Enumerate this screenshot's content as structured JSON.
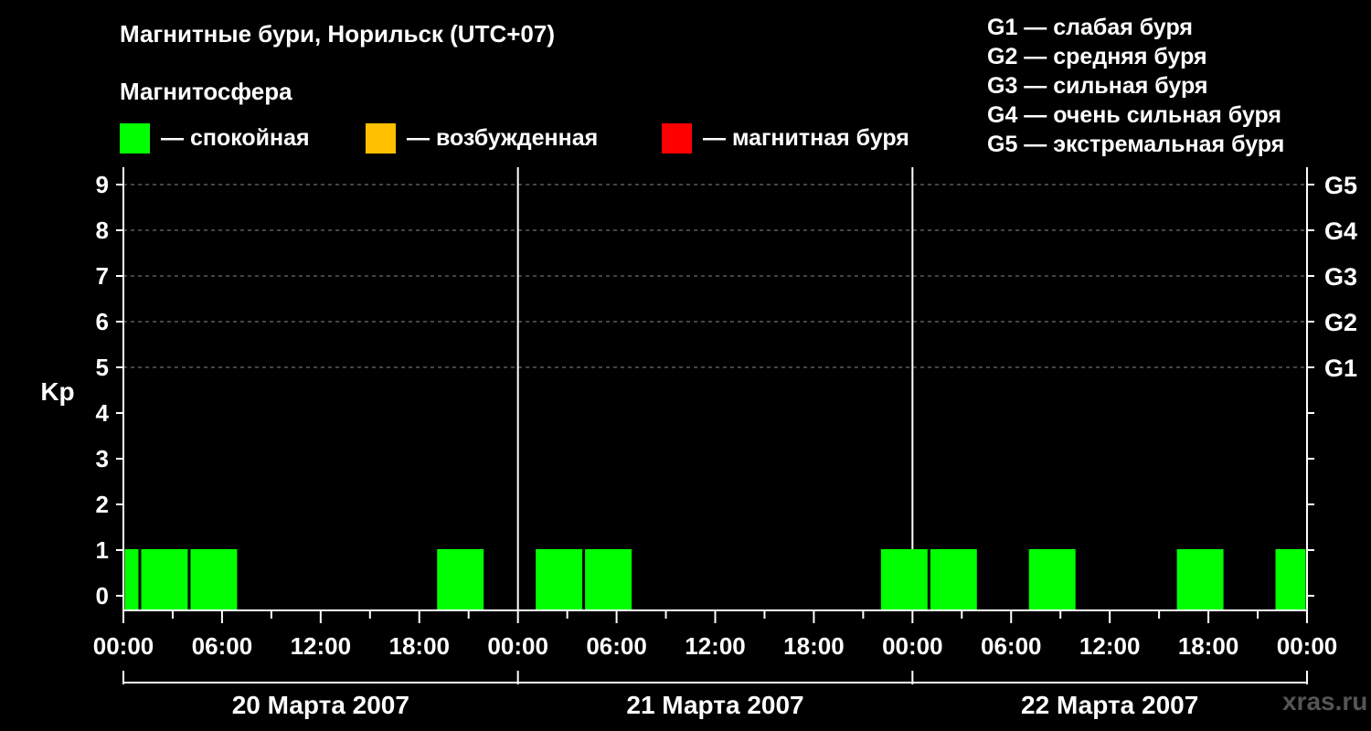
{
  "title": "Магнитные бури, Норильск (UTC+07)",
  "legend": {
    "heading": "Магнитосфера",
    "items": [
      {
        "label": "— спокойная",
        "color": "#00ff00"
      },
      {
        "label": "— возбужденная",
        "color": "#ffc000"
      },
      {
        "label": "— магнитная буря",
        "color": "#ff0000"
      }
    ]
  },
  "g_scale": [
    "G1 — слабая буря",
    "G2 — средняя буря",
    "G3 — сильная буря",
    "G4 — очень сильная буря",
    "G5 — экстремальная буря"
  ],
  "watermark": "xras.ru",
  "chart_data": {
    "type": "bar",
    "ylabel": "Kp",
    "ylim": [
      0,
      9
    ],
    "y_ticks": [
      0,
      1,
      2,
      3,
      4,
      5,
      6,
      7,
      8,
      9
    ],
    "right_axis_labels": [
      {
        "kp": 5,
        "label": "G1"
      },
      {
        "kp": 6,
        "label": "G2"
      },
      {
        "kp": 7,
        "label": "G3"
      },
      {
        "kp": 8,
        "label": "G4"
      },
      {
        "kp": 9,
        "label": "G5"
      }
    ],
    "x_range_hours": [
      0,
      72
    ],
    "x_tick_labels": [
      "00:00",
      "06:00",
      "12:00",
      "18:00",
      "00:00",
      "06:00",
      "12:00",
      "18:00",
      "00:00",
      "06:00",
      "12:00",
      "18:00",
      "00:00"
    ],
    "days": [
      "20 Марта 2007",
      "21 Марта 2007",
      "22 Марта 2007"
    ],
    "grid": "horizontal dashed at Kp 5–9",
    "bars": [
      {
        "start": "20 Марта 2007 00:00",
        "end": "20 Марта 2007 01:00",
        "kp": 1,
        "status": "спокойная"
      },
      {
        "start": "20 Марта 2007 01:00",
        "end": "20 Марта 2007 04:00",
        "kp": 1,
        "status": "спокойная"
      },
      {
        "start": "20 Марта 2007 04:00",
        "end": "20 Марта 2007 07:00",
        "kp": 1,
        "status": "спокойная"
      },
      {
        "start": "20 Марта 2007 19:00",
        "end": "20 Марта 2007 22:00",
        "kp": 1,
        "status": "спокойная"
      },
      {
        "start": "21 Марта 2007 01:00",
        "end": "21 Марта 2007 04:00",
        "kp": 1,
        "status": "спокойная"
      },
      {
        "start": "21 Марта 2007 04:00",
        "end": "21 Марта 2007 07:00",
        "kp": 1,
        "status": "спокойная"
      },
      {
        "start": "21 Марта 2007 22:00",
        "end": "22 Марта 2007 01:00",
        "kp": 1,
        "status": "спокойная"
      },
      {
        "start": "22 Марта 2007 01:00",
        "end": "22 Марта 2007 04:00",
        "kp": 1,
        "status": "спокойная"
      },
      {
        "start": "22 Марта 2007 07:00",
        "end": "22 Марта 2007 10:00",
        "kp": 1,
        "status": "спокойная"
      },
      {
        "start": "22 Марта 2007 16:00",
        "end": "22 Марта 2007 19:00",
        "kp": 1,
        "status": "спокойная"
      },
      {
        "start": "22 Марта 2007 22:00",
        "end": "23 Марта 2007 00:00",
        "kp": 1,
        "status": "спокойная"
      }
    ]
  }
}
